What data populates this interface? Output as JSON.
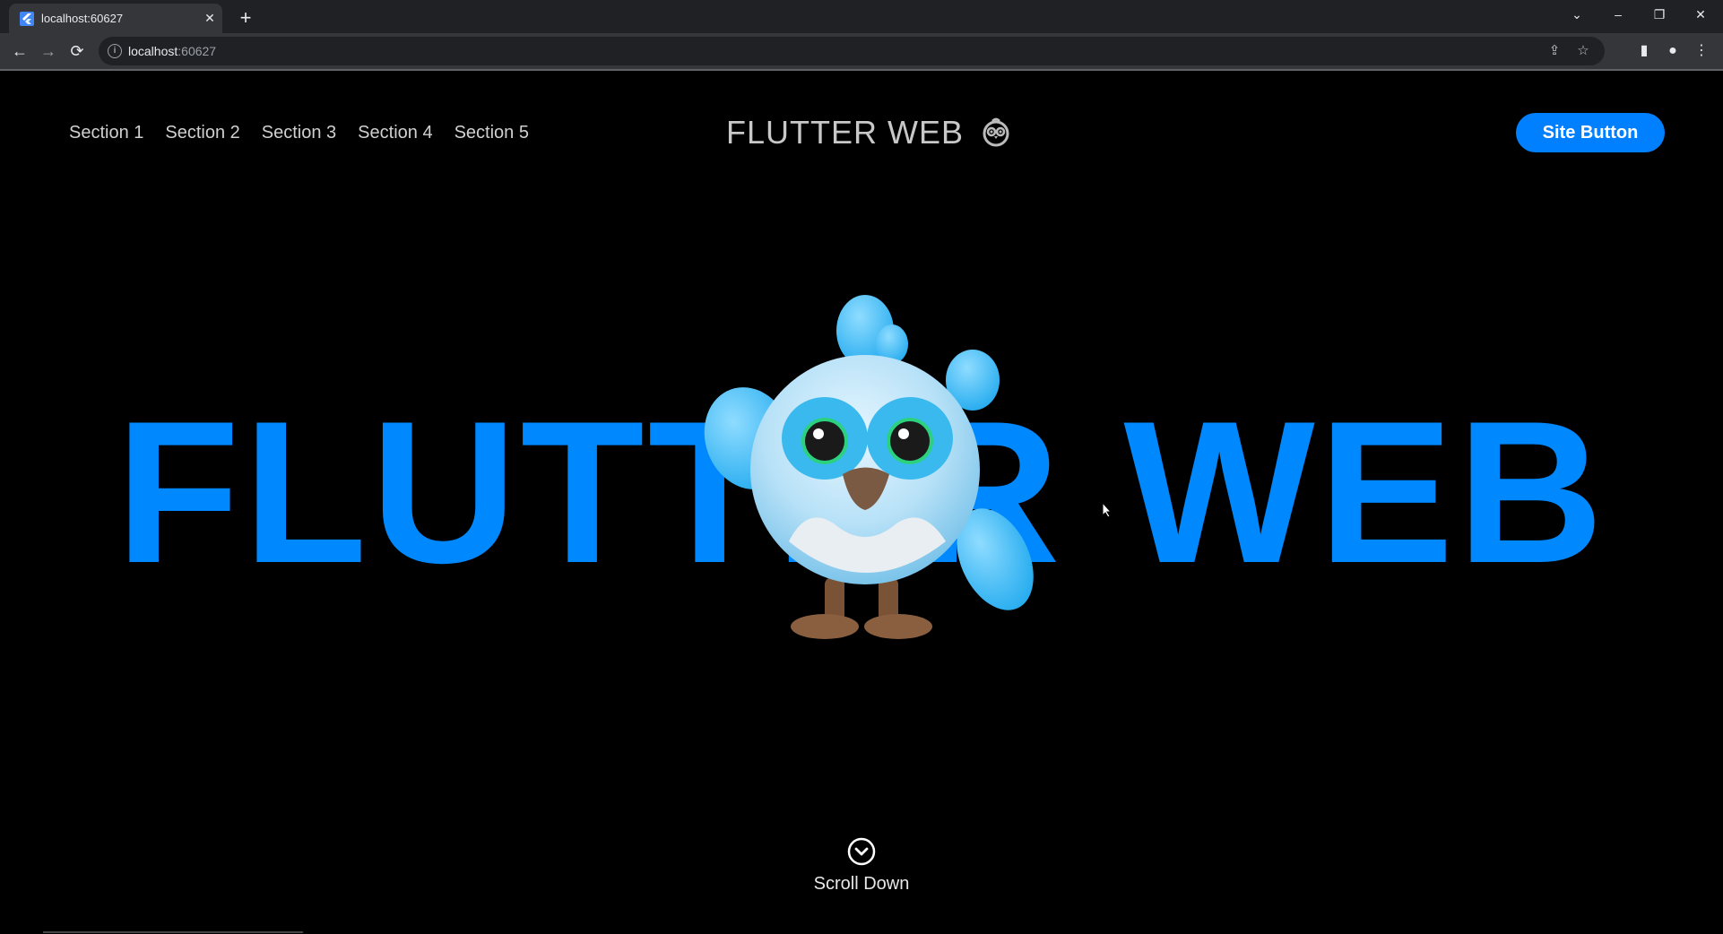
{
  "browser": {
    "tab_title": "localhost:60627",
    "tab_close": "✕",
    "new_tab": "+",
    "url_host": "localhost",
    "url_port": ":60627",
    "window_controls": {
      "dropdown": "⌄",
      "minimize": "–",
      "restore": "❐",
      "close": "✕"
    }
  },
  "nav": {
    "links": [
      "Section 1",
      "Section 2",
      "Section 3",
      "Section 4",
      "Section 5"
    ]
  },
  "brand": {
    "title": "FLUTTER WEB"
  },
  "site_button": {
    "label": "Site Button"
  },
  "hero": {
    "title": "FLUTTER WEB"
  },
  "scroll": {
    "label": "Scroll Down"
  },
  "colors": {
    "accent": "#0088ff",
    "button": "#0080ff",
    "background": "#000000"
  }
}
